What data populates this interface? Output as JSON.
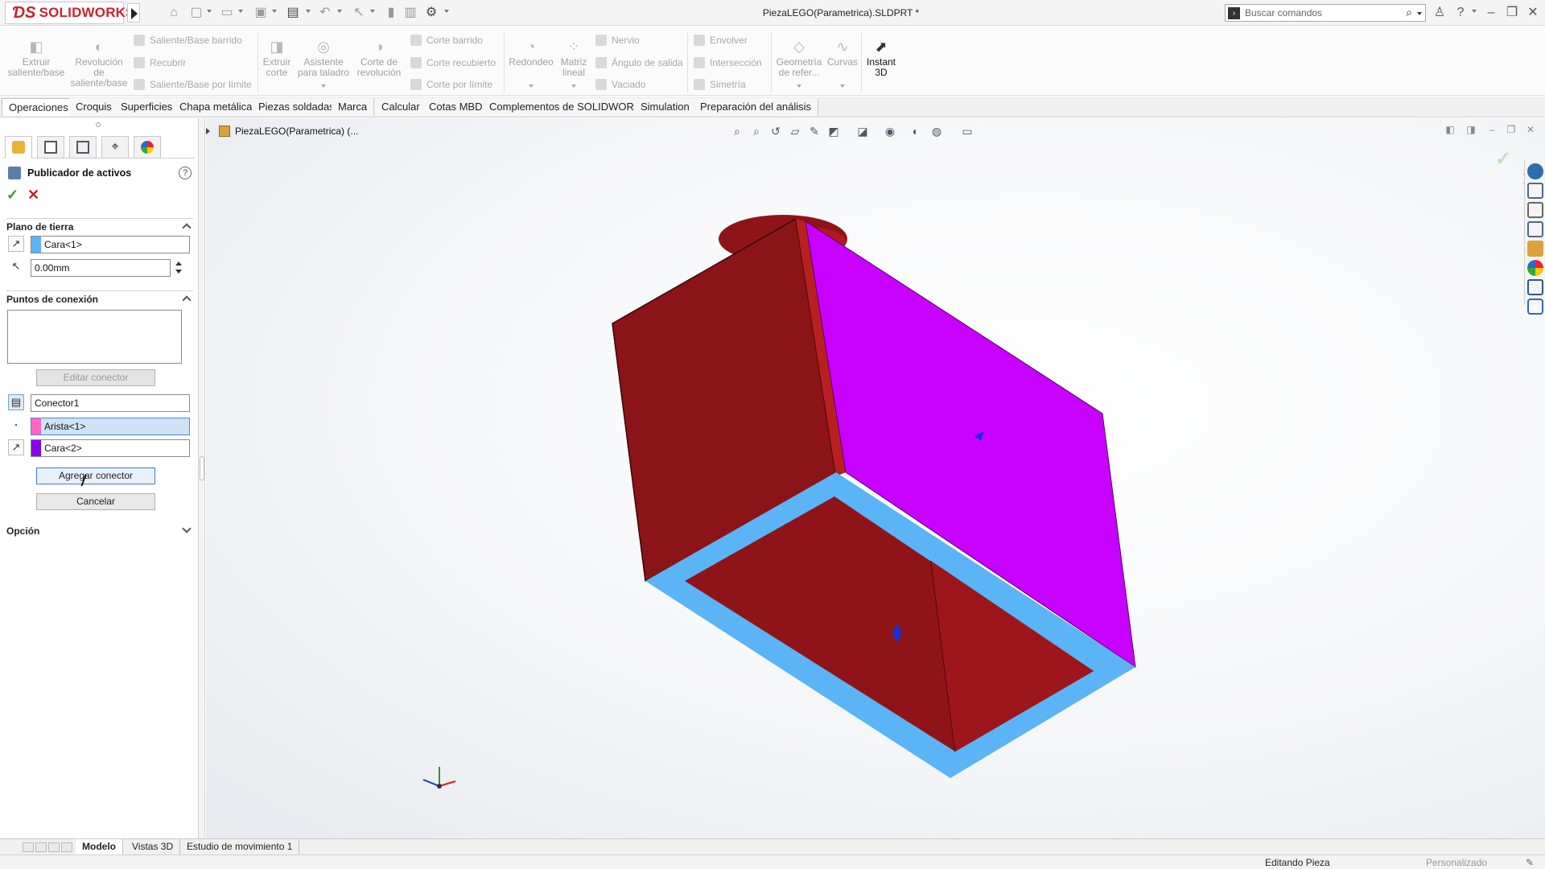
{
  "app": {
    "logo_text": "SOLIDWORKS",
    "document_title": "PiezaLEGO(Parametrica).SLDPRT *"
  },
  "search": {
    "placeholder": "Buscar comandos"
  },
  "ribbon": {
    "extrude_boss": "Extruir\nsaliente/base",
    "revolve_boss": "Revolución\nde\nsaliente/base",
    "swept_boss": "Saliente/Base barrido",
    "loft_boss": "Recubrir",
    "boundary_boss": "Saliente/Base por límite",
    "extrude_cut": "Extruir\ncorte",
    "hole_wizard": "Asistente\npara taladro",
    "revolve_cut": "Corte de\nrevolución",
    "swept_cut": "Corte barrido",
    "lofted_cut": "Corte recubierto",
    "boundary_cut": "Corte por límite",
    "fillet": "Redondeo",
    "linear_pattern": "Matriz\nlineal",
    "rib": "Nervio",
    "draft": "Ángulo de salida",
    "shell": "Vaciado",
    "wrap": "Envolver",
    "intersect": "Intersección",
    "mirror": "Simetría",
    "ref_geometry": "Geometría\nde refer...",
    "curves": "Curvas",
    "instant3d": "Instant\n3D"
  },
  "tabs": [
    "Operaciones",
    "Croquis",
    "Superficies",
    "Chapa metálica",
    "Piezas soldadas",
    "Marca",
    "Calcular",
    "Cotas MBD",
    "Complementos de SOLIDWORKS",
    "Simulation",
    "Preparación del análisis"
  ],
  "property_manager": {
    "title": "Publicador de activos",
    "help": "?",
    "ground_plane": {
      "header": "Plano de tierra",
      "face_value": "Cara<1>",
      "offset_value": "0.00mm"
    },
    "connection_points": {
      "header": "Puntos de conexión",
      "edit_button": "Editar conector",
      "connector_name": "Conector1",
      "edge_value": "Arista<1>",
      "face_value": "Cara<2>",
      "add_button": "Agregar conector",
      "cancel_button": "Cancelar"
    },
    "option": {
      "header": "Opción"
    }
  },
  "viewport": {
    "tree_node": "PiezaLEGO(Parametrica)  (..."
  },
  "bottom_tabs": [
    "Modelo",
    "Vistas 3D",
    "Estudio de movimiento 1"
  ],
  "status": {
    "mode": "Editando Pieza",
    "units": "Personalizado"
  },
  "colors": {
    "model_red": "#8f1418",
    "model_face_magenta": "#c800ff",
    "model_face_blue": "#5ab4f5",
    "ok_green": "#2e9a2e",
    "cancel_red": "#c0241c"
  }
}
